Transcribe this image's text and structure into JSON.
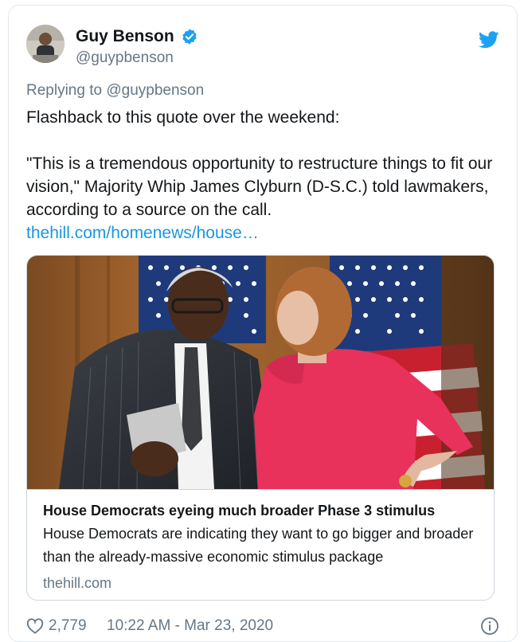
{
  "tweet": {
    "display_name": "Guy Benson",
    "handle": "@guypbenson",
    "reply_prefix": "Replying to ",
    "reply_to": "@guypbenson",
    "text_line1": "Flashback to this quote over the weekend:",
    "text_quote": "\"This is a tremendous opportunity to restructure things to fit our vision,\" Majority Whip James Clyburn (D-S.C.) told lawmakers, according to a source on the call.",
    "link": "thehill.com/homenews/house…"
  },
  "card": {
    "title": "House Democrats eyeing much broader Phase 3 stimulus",
    "description": "House Democrats are indicating they want to go bigger and broader than the already-massive economic stimulus package",
    "domain": "thehill.com"
  },
  "footer": {
    "likes": "2,779",
    "timestamp": "10:22 AM - Mar 23, 2020"
  },
  "colors": {
    "link": "#1b95e0",
    "secondary_text": "#657786",
    "twitter_blue": "#1da1f2",
    "dress": "#e8315b"
  },
  "icons": {
    "verified": "verified-badge-icon",
    "bird": "twitter-bird-icon",
    "like": "heart-icon",
    "info": "info-icon"
  }
}
